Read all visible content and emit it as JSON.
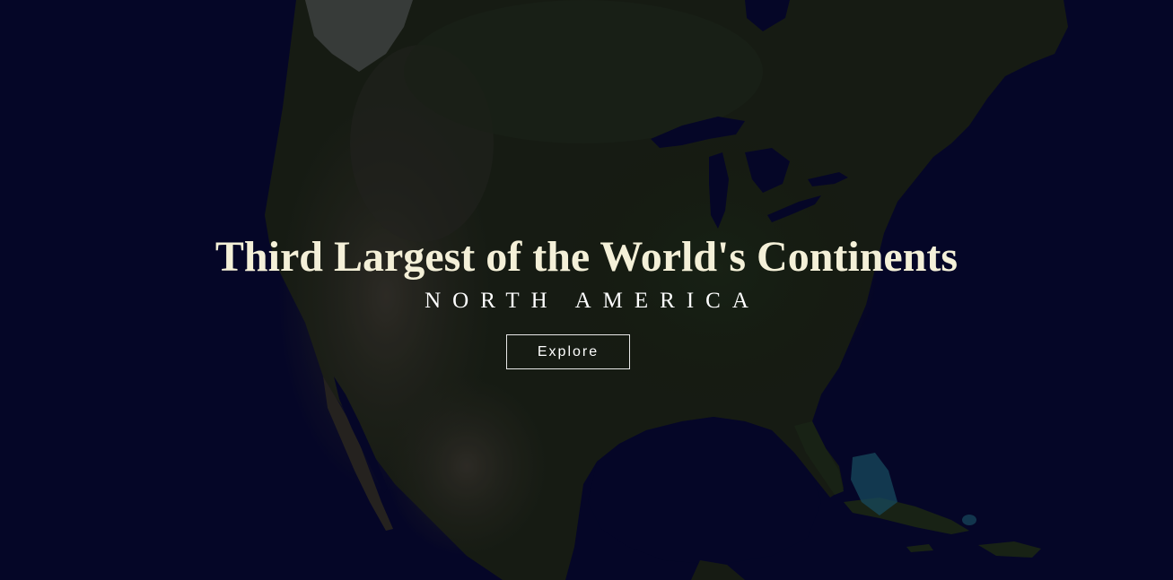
{
  "hero": {
    "title": "Third Largest of the World's Continents",
    "subtitle": "NORTH AMERICA",
    "cta_label": "Explore"
  },
  "background": {
    "image": "north-america-satellite-map",
    "ocean_color": "#070830",
    "land_color": "#1c2218"
  }
}
